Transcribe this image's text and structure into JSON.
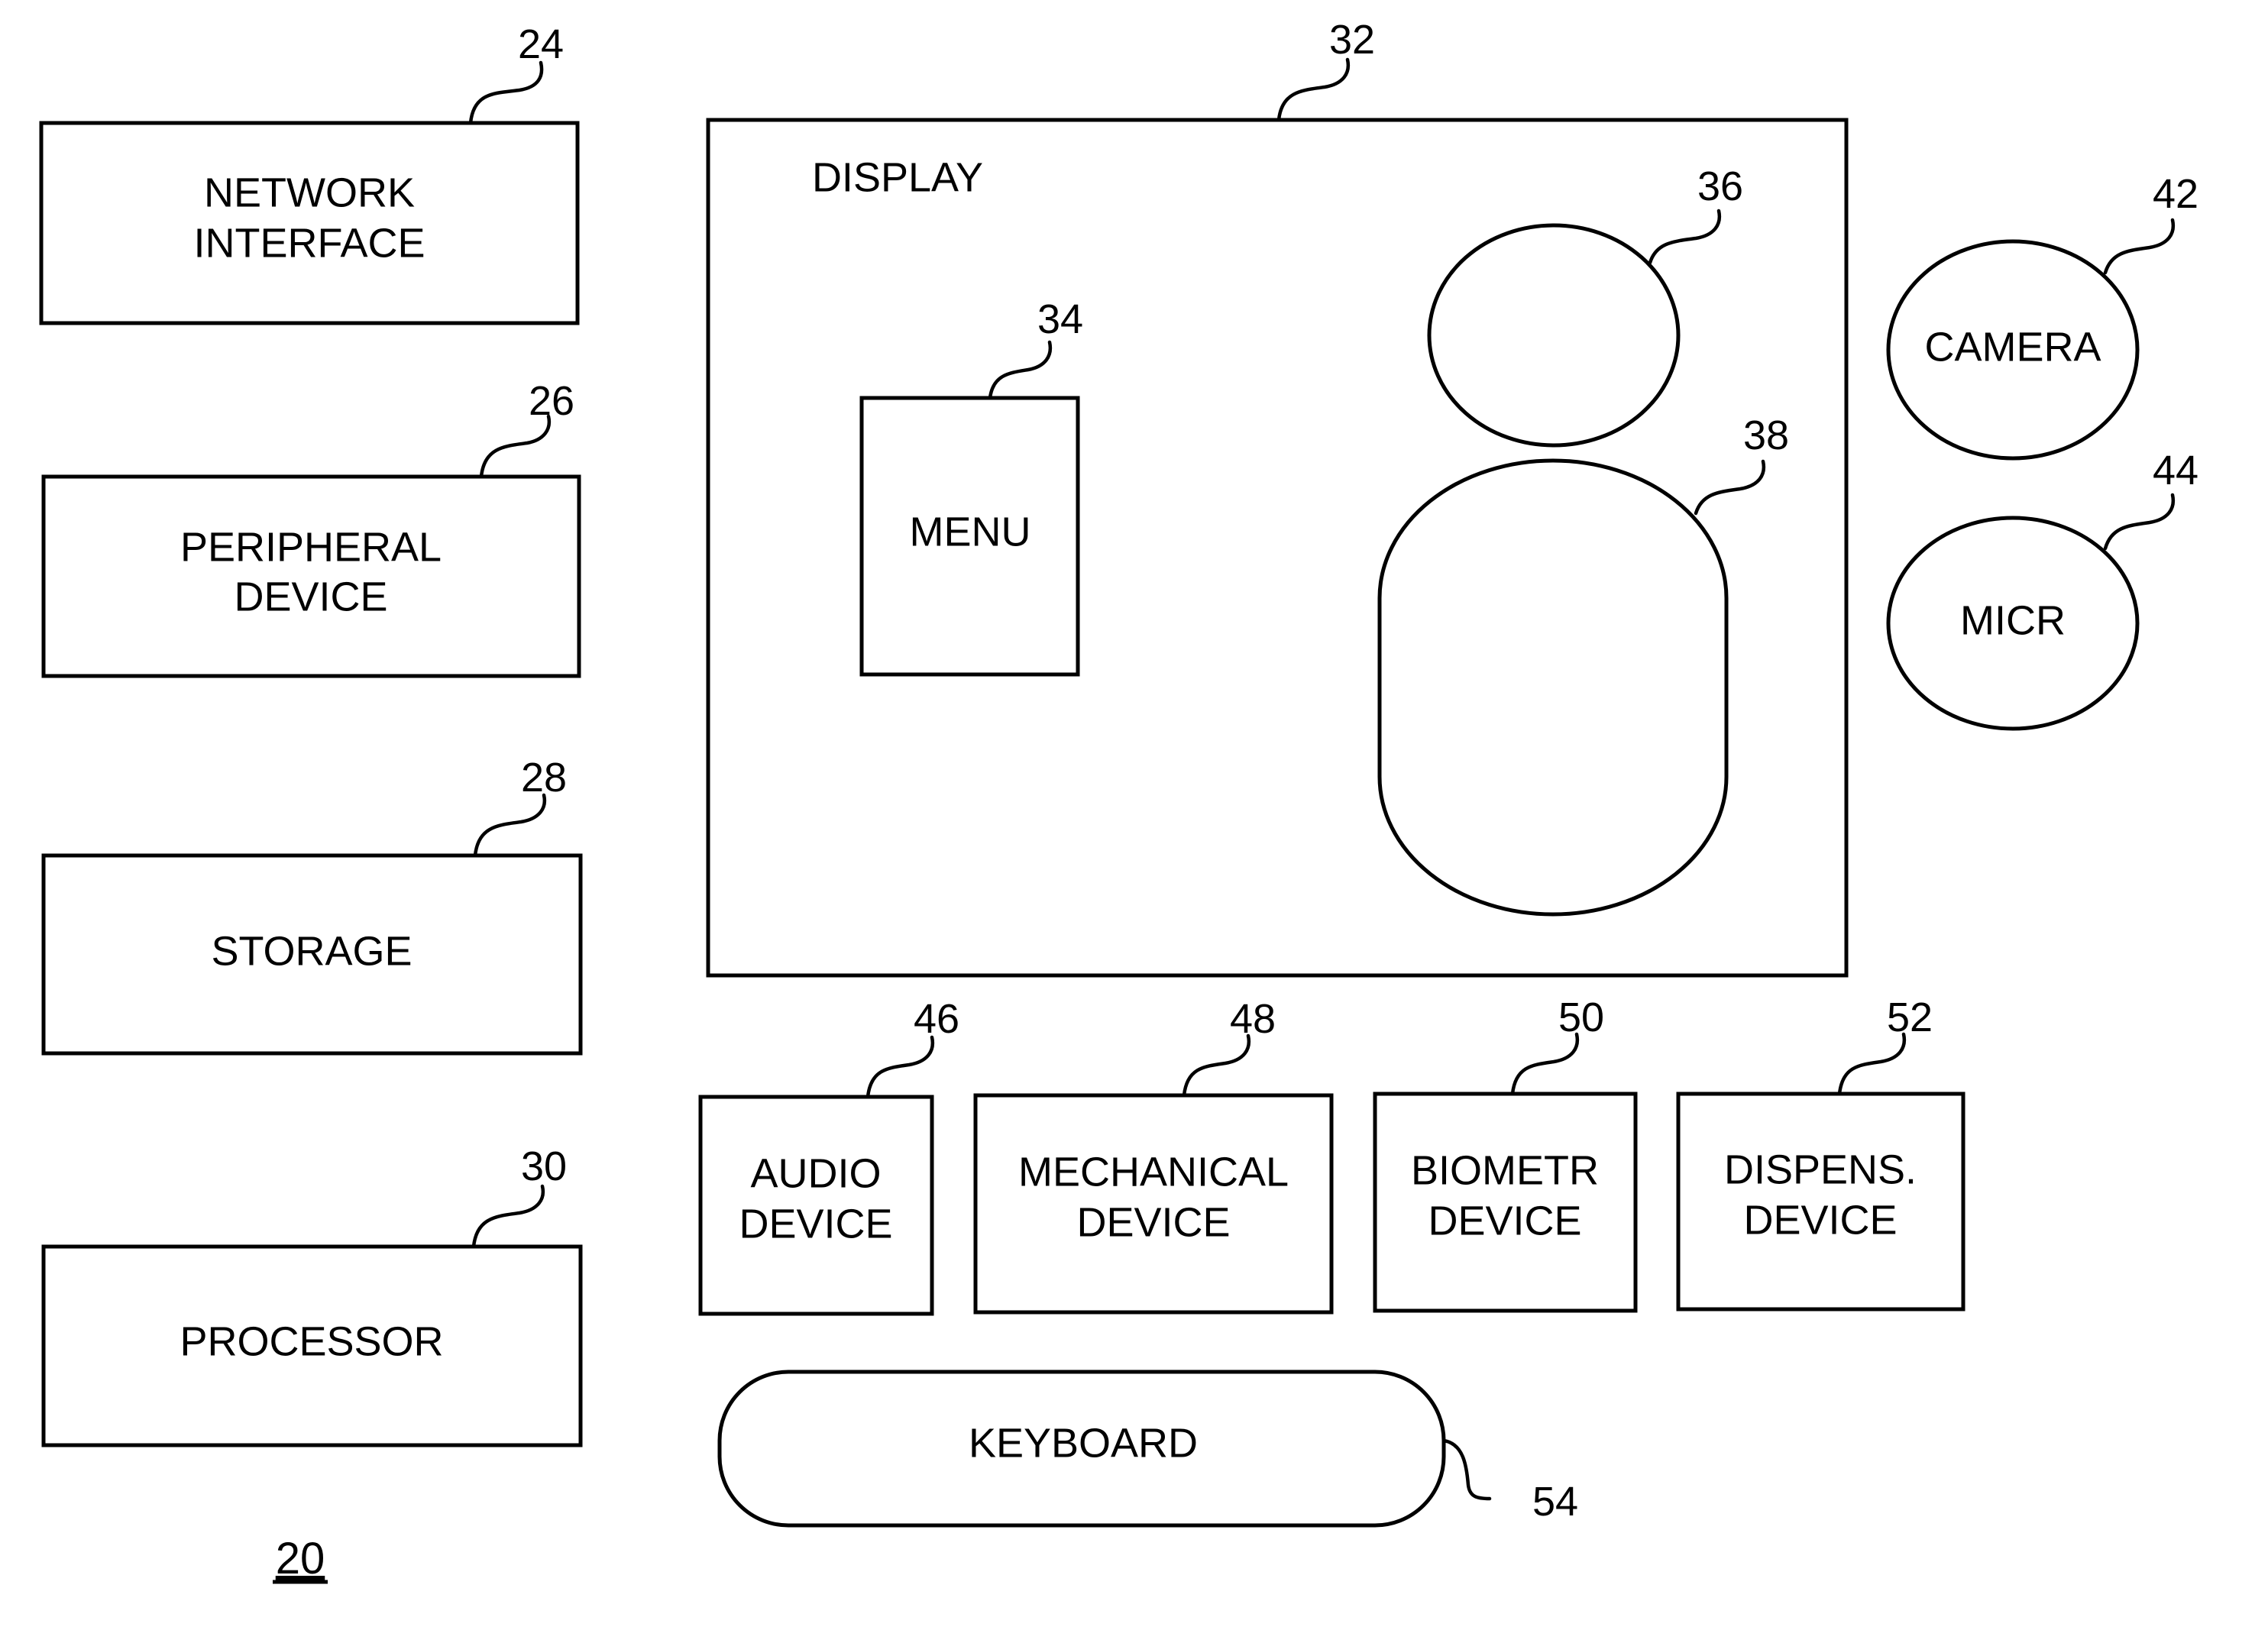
{
  "figure": {
    "number": "20",
    "colors": {
      "line": "#000000",
      "background": "#ffffff"
    }
  },
  "left_column": [
    {
      "ref": "24",
      "lines": [
        "NETWORK",
        "INTERFACE"
      ]
    },
    {
      "ref": "26",
      "lines": [
        "PERIPHERAL",
        "DEVICE"
      ]
    },
    {
      "ref": "28",
      "lines": [
        "STORAGE"
      ]
    },
    {
      "ref": "30",
      "lines": [
        "PROCESSOR"
      ]
    }
  ],
  "display": {
    "ref": "32",
    "title": "DISPLAY",
    "menu": {
      "ref": "34",
      "label": "MENU"
    },
    "head_circle": {
      "ref": "36"
    },
    "body_capsule": {
      "ref": "38"
    }
  },
  "side_devices": [
    {
      "ref": "42",
      "label": "CAMERA"
    },
    {
      "ref": "44",
      "label": "MICR"
    }
  ],
  "bottom_row": [
    {
      "ref": "46",
      "lines": [
        "AUDIO",
        "DEVICE"
      ]
    },
    {
      "ref": "48",
      "lines": [
        "MECHANICAL",
        "DEVICE"
      ]
    },
    {
      "ref": "50",
      "lines": [
        "BIOMETR",
        "DEVICE"
      ]
    },
    {
      "ref": "52",
      "lines": [
        "DISPENS.",
        "DEVICE"
      ]
    }
  ],
  "keyboard": {
    "ref": "54",
    "label": "KEYBOARD"
  }
}
